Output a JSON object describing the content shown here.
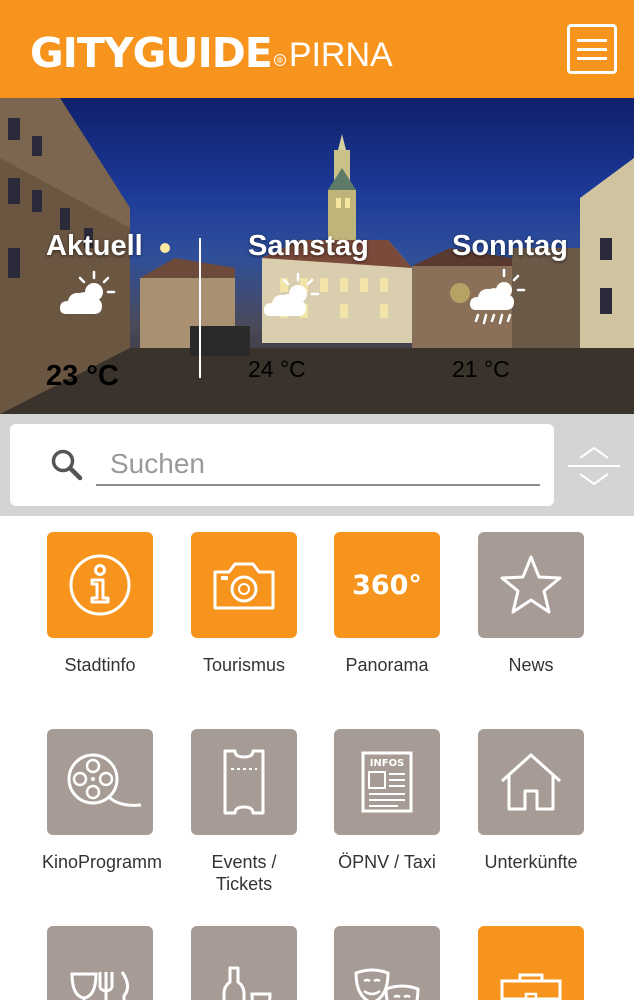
{
  "header": {
    "logo_main": "GITYGUIDE",
    "logo_reg": "®",
    "logo_city": "PIRNA",
    "menu_icon": "hamburger-menu-icon",
    "background_color": "#f7941d"
  },
  "weather": [
    {
      "day": "Aktuell",
      "temp": "23 °C",
      "icon": "partly-cloudy-icon"
    },
    {
      "day": "Samstag",
      "temp": "24 °C",
      "icon": "partly-cloudy-icon"
    },
    {
      "day": "Sonntag",
      "temp": "21 °C",
      "icon": "rain-cloud-icon"
    }
  ],
  "search": {
    "placeholder": "Suchen",
    "value": "",
    "icon": "search-icon",
    "sort_icon": "expand-collapse-icon"
  },
  "tiles": [
    {
      "label": "Stadtinfo",
      "icon": "info-icon",
      "color": "#f7941d"
    },
    {
      "label": "Tourismus",
      "icon": "camera-icon",
      "color": "#f7941d"
    },
    {
      "label": "Panorama",
      "icon": "panorama-360-icon",
      "icon_text": "360°",
      "color": "#f7941d"
    },
    {
      "label": "News",
      "icon": "star-icon",
      "color": "#a69c95"
    },
    {
      "label": "KinoProgramm",
      "icon": "film-reel-icon",
      "color": "#a69c95"
    },
    {
      "label": "Events / Tickets",
      "icon": "ticket-icon",
      "color": "#a69c95"
    },
    {
      "label": "ÖPNV / Taxi",
      "icon": "infos-board-icon",
      "icon_text": "INFOS",
      "color": "#a69c95"
    },
    {
      "label": "Unterkünfte",
      "icon": "house-icon",
      "color": "#a69c95"
    },
    {
      "label": "",
      "icon": "wine-dining-icon",
      "color": "#a69c95"
    },
    {
      "label": "",
      "icon": "bottle-glass-icon",
      "color": "#a69c95"
    },
    {
      "label": "",
      "icon": "theater-masks-icon",
      "color": "#a69c95"
    },
    {
      "label": "",
      "icon": "briefcase-icon",
      "color": "#f7941d"
    }
  ]
}
